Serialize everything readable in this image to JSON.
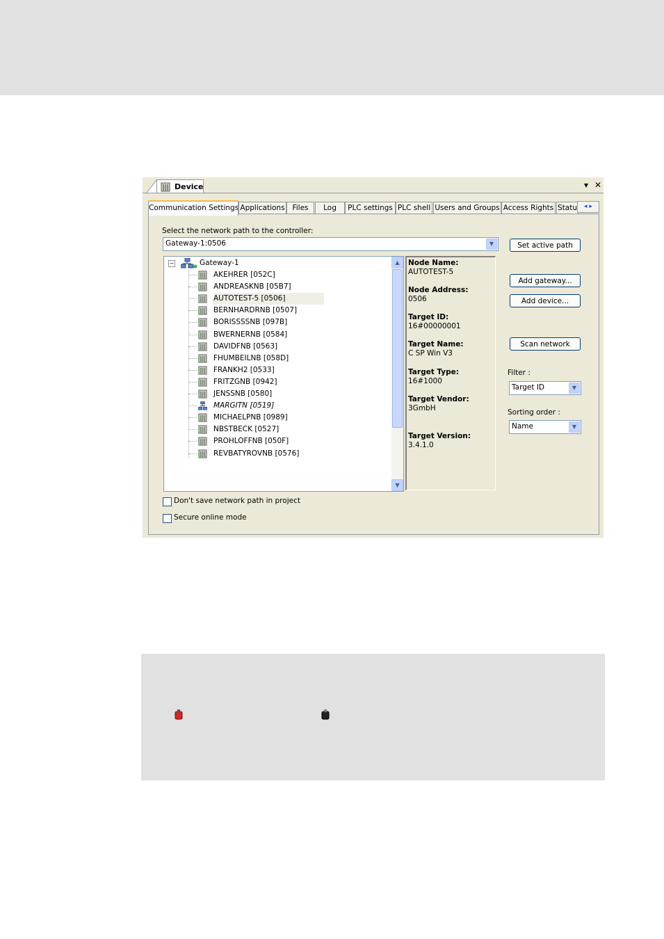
{
  "window": {
    "title": "Device",
    "dropdown_glyph": "▾",
    "close_glyph": "✕",
    "tab_scroll_glyphs": "◂ ▸"
  },
  "tabs": [
    {
      "label": "Communication Settings"
    },
    {
      "label": "Applications"
    },
    {
      "label": "Files"
    },
    {
      "label": "Log"
    },
    {
      "label": "PLC settings"
    },
    {
      "label": "PLC shell"
    },
    {
      "label": "Users and Groups"
    },
    {
      "label": "Access Rights"
    },
    {
      "label": "Statu"
    }
  ],
  "comm": {
    "path_label": "Select the network path to the controller:",
    "path_value": "Gateway-1:0506",
    "buttons": {
      "set_active_path": "Set active path",
      "add_gateway": "Add gateway...",
      "add_device": "Add device...",
      "scan_network": "Scan network"
    },
    "filter_label": "Filter :",
    "filter_value": "Target ID",
    "sorting_label": "Sorting order :",
    "sorting_value": "Name",
    "checkboxes": {
      "dont_save": "Don't save network path in project",
      "secure_online": "Secure online mode"
    }
  },
  "tree": {
    "gateway": "Gateway-1",
    "expander": "⊟",
    "devices": [
      {
        "label": "AKEHRER [052C]"
      },
      {
        "label": "ANDREASKNB [05B7]"
      },
      {
        "label": "AUTOTEST-5 [0506]",
        "selected": true
      },
      {
        "label": "BERNHARDRNB [0507]"
      },
      {
        "label": "BORISSSSNB [097B]"
      },
      {
        "label": "BWERNERNB [0584]"
      },
      {
        "label": "DAVIDFNB [0563]"
      },
      {
        "label": "FHUMBEILNB [058D]"
      },
      {
        "label": "FRANKH2 [0533]"
      },
      {
        "label": "FRITZGNB [0942]"
      },
      {
        "label": "JENSSNB [0580]"
      },
      {
        "label": "MARGITN [0519]",
        "italic": true,
        "icon": "network-icon"
      },
      {
        "label": "MICHAELPNB [0989]"
      },
      {
        "label": "NBSTBECK [0527]"
      },
      {
        "label": "PROHLOFFNB [050F]"
      },
      {
        "label": "REVBATYROVNB [0576]"
      }
    ]
  },
  "info": {
    "node_name_label": "Node Name:",
    "node_name": "AUTOTEST-5",
    "node_address_label": "Node Address:",
    "node_address": "0506",
    "target_id_label": "Target ID:",
    "target_id": "16#00000001",
    "target_name_label": "Target Name:",
    "target_name": "C  SP Win V3",
    "target_type_label": "Target Type:",
    "target_type": "16#1000",
    "target_vendor_label": "Target Vendor:",
    "target_vendor": "3GmbH",
    "target_version_label": "Target Version:",
    "target_version": "3.4.1.0"
  },
  "note": {
    "icons": [
      "red-device-icon",
      "black-device-icon"
    ]
  }
}
